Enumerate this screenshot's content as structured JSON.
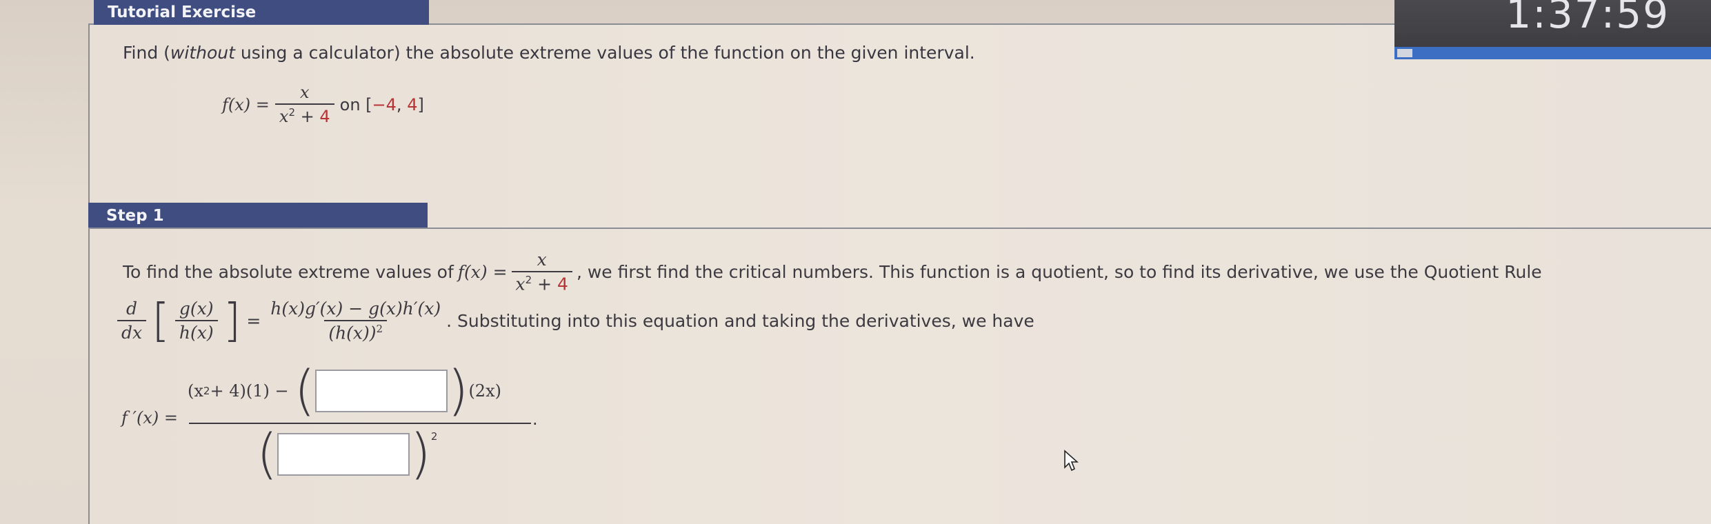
{
  "header": {
    "tab_title": "Tutorial Exercise",
    "timer": "1:37:59"
  },
  "question": {
    "pre": "Find (",
    "italic": "without",
    "post": " using a calculator) the absolute extreme values of the function on the given interval.",
    "fx_lhs": "f(x) =",
    "fx_num": "x",
    "fx_den_a": "x",
    "fx_den_exp": "2",
    "fx_den_b": " + ",
    "fx_den_const": "4",
    "interval_pre": "on [",
    "interval_a": "−4",
    "interval_sep": ", ",
    "interval_b": "4",
    "interval_post": "]"
  },
  "step": {
    "label": "Step 1",
    "text1": "To find the absolute extreme values of",
    "text1_lhs": "f(x) =",
    "text1_num": "x",
    "text1_den_a": "x",
    "text1_den_exp": "2",
    "text1_den_b": " + ",
    "text1_den_const": "4",
    "text2": ", we first find the critical numbers. This function is a quotient, so to find its derivative, we use the Quotient Rule",
    "qr_d_num": "d",
    "qr_d_den": "dx",
    "qr_g": "g(x)",
    "qr_h": "h(x)",
    "qr_eq": "=",
    "qr_rhs_num": "h(x)g′(x) − g(x)h′(x)",
    "qr_rhs_den": "(h(x))",
    "qr_rhs_den_exp": "2",
    "text3": ". Substituting into this equation and taking the derivatives, we have",
    "fprime_label": "f ′(x) =",
    "num_a": "(x",
    "num_a_exp": "2",
    "num_b": " + 4)(1) −",
    "num_c": "(2x)",
    "den_exp": "2",
    "end_period": "."
  }
}
